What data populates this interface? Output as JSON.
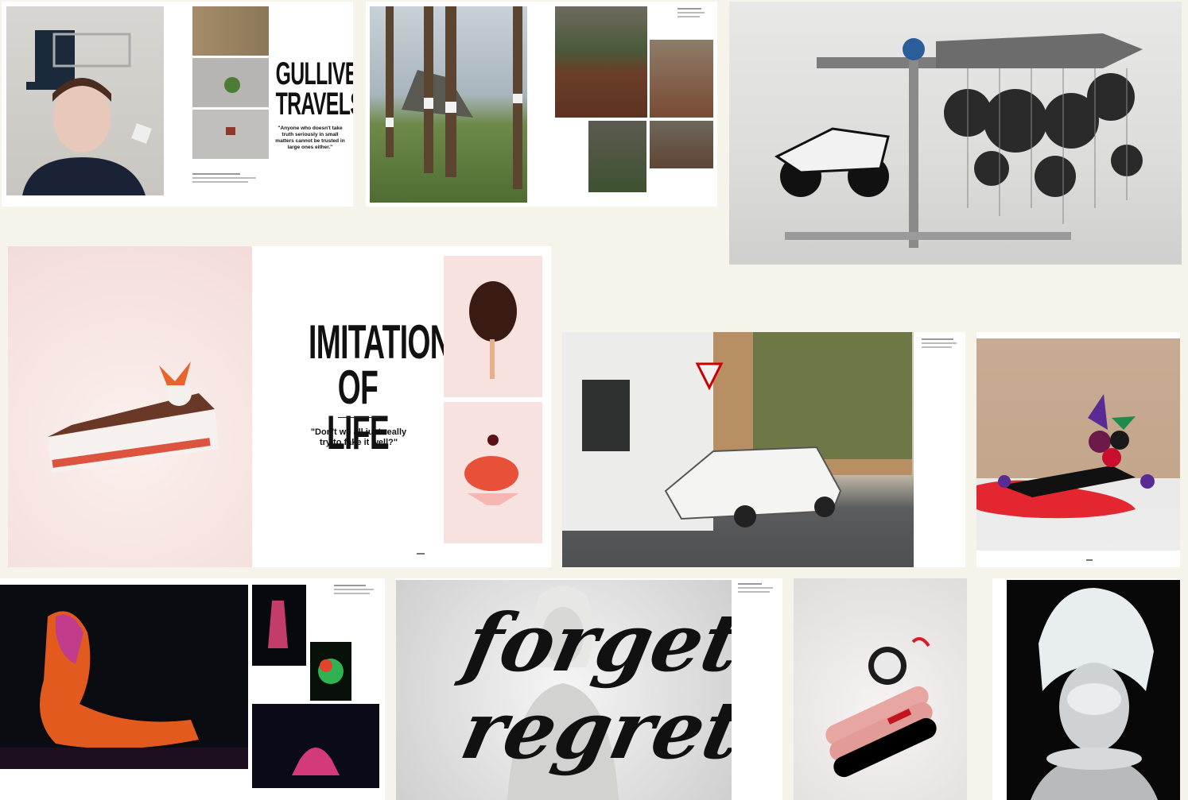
{
  "spreads": {
    "gulliver": {
      "title_line1": "GULLIVER'S",
      "title_line2": "TRAVELS",
      "quote": "\"Anyone who doesn't take truth seriously in small matters cannot be trusted in large ones either.\""
    },
    "imitation": {
      "title_line1": "IMITATION",
      "title_line2": "OF LIFE",
      "quote_line1": "\"Don't we all just really",
      "quote_line2": "try to fake it well?\""
    },
    "forget": {
      "word1": "forget",
      "word2": "regret"
    }
  }
}
